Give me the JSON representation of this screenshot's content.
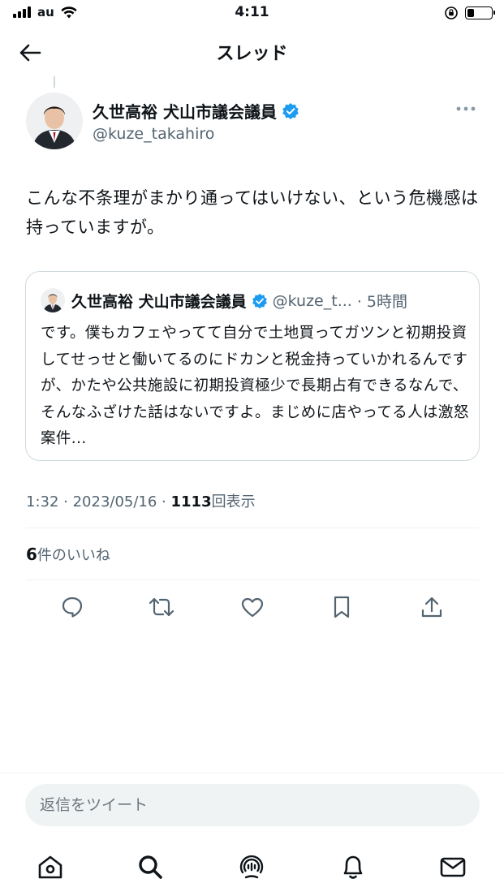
{
  "status_bar": {
    "carrier": "au",
    "time": "4:11",
    "battery_level": 0.3
  },
  "header": {
    "title": "スレッド",
    "back_icon": "arrow-left-icon"
  },
  "tweet": {
    "author_name": "久世高裕 犬山市議会議員",
    "author_handle": "@kuze_takahiro",
    "verified": true,
    "text": "こんな不条理がまかり通ってはいけない、という危機感は持っていますが。",
    "quote": {
      "author_name": "久世高裕 犬山市議会議員",
      "author_handle": "@kuze_t...",
      "time": "· 5時間",
      "text": "です。僕もカフェやってて自分で土地買ってガツンと初期投資してせっせと働いてるのにドカンと税金持っていかれるんですが、かたや公共施設に初期投資極少で長期占有できるなんで、そんなふざけた話はないですよ。まじめに店やってる人は激怒案件..."
    },
    "timestamp": "1:32 · 2023/05/16 · ",
    "views_count": "1113",
    "views_label": "回表示",
    "likes_count": "6",
    "likes_label": "件のいいね"
  },
  "actions": [
    "reply-icon",
    "retweet-icon",
    "like-icon",
    "bookmark-icon",
    "share-icon"
  ],
  "reply": {
    "placeholder": "返信をツイート"
  },
  "tabbar": [
    "home-icon",
    "search-icon",
    "spaces-icon",
    "notifications-icon",
    "messages-icon"
  ],
  "colors": {
    "verified_blue": "#1d9bf0",
    "text_primary": "#0f1419",
    "text_secondary": "#536471"
  }
}
